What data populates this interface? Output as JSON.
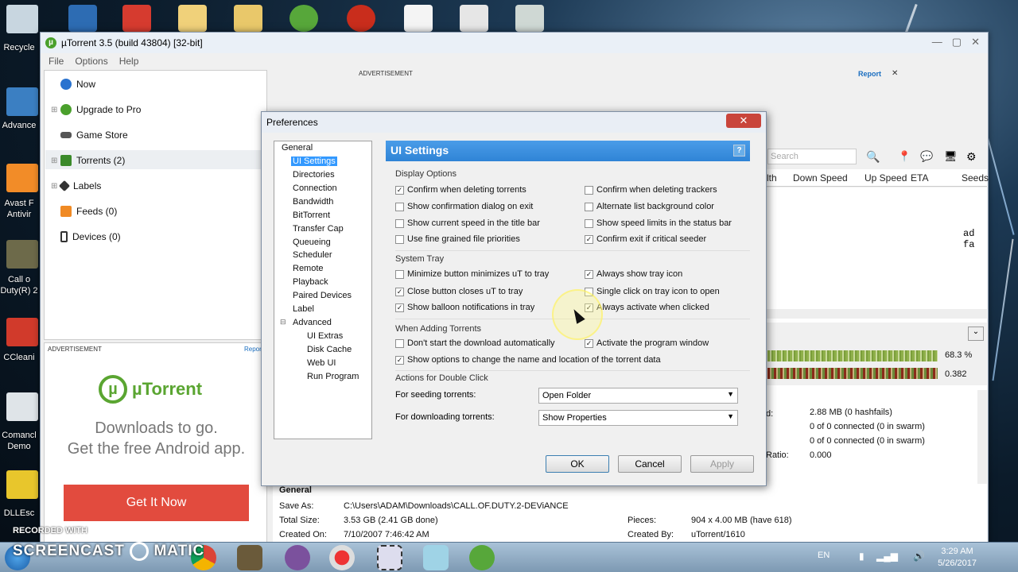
{
  "desktop": {
    "labels": [
      "Recycle",
      "Advance",
      "Avast F",
      "Antivir",
      "Call o",
      "Duty(R) 2",
      "CCleani",
      "Comancl",
      "Demo",
      "DLLEsc"
    ]
  },
  "window": {
    "title": "µTorrent 3.5  (build 43804) [32-bit]",
    "menu": [
      "File",
      "Options",
      "Help"
    ]
  },
  "sidebar": {
    "items": [
      "Now",
      "Upgrade to Pro",
      "Game Store",
      "Torrents (2)",
      "Labels",
      "Feeds (0)",
      "Devices (0)"
    ]
  },
  "ad_left": {
    "label": "ADVERTISEMENT",
    "report": "Report",
    "brand": "µTorrent",
    "line1": "Downloads to go.",
    "line2": "Get the free Android app.",
    "button": "Get It Now"
  },
  "ad_top": {
    "label": "ADVERTISEMENT",
    "report": "Report",
    "close": "✕"
  },
  "toolbar": {
    "search_placeholder": "Search"
  },
  "columns": [
    "lth",
    "Down Speed",
    "Up Speed",
    "ETA",
    "Seeds"
  ],
  "right_text": "ad fa",
  "progress": {
    "pct1": "68.3 %",
    "pct2": "0.382",
    "fill1": 0.683
  },
  "details_right": [
    "2.88 MB (0 hashfails)",
    "0 of 0 connected (0 in swarm)",
    "0 of 0 connected (0 in swarm)",
    "0.000"
  ],
  "details_labels": {
    "d": "d:",
    "ratio": "Ratio:"
  },
  "general": {
    "header": "General",
    "save_as_label": "Save As:",
    "save_as": "C:\\Users\\ADAM\\Downloads\\CALL.OF.DUTY.2-DEViANCE",
    "total_size_label": "Total Size:",
    "total_size": "3.53 GB (2.41 GB done)",
    "created_on_label": "Created On:",
    "created_on": "7/10/2007 7:46:42 AM",
    "pieces_label": "Pieces:",
    "pieces": "904 x 4.00 MB (have 618)",
    "created_by_label": "Created By:",
    "created_by": "uTorrent/1610"
  },
  "dialog": {
    "title": "Preferences",
    "tree": [
      "General",
      "UI Settings",
      "Directories",
      "Connection",
      "Bandwidth",
      "BitTorrent",
      "Transfer Cap",
      "Queueing",
      "Scheduler",
      "Remote",
      "Playback",
      "Paired Devices",
      "Label",
      "Advanced",
      "UI Extras",
      "Disk Cache",
      "Web UI",
      "Run Program"
    ],
    "panel_title": "UI Settings",
    "help": "?",
    "sections": {
      "display": "Display Options",
      "tray": "System Tray",
      "adding": "When Adding Torrents",
      "double": "Actions for Double Click"
    },
    "checks": {
      "c1": "Confirm when deleting torrents",
      "c2": "Confirm when deleting trackers",
      "c3": "Show confirmation dialog on exit",
      "c4": "Alternate list background color",
      "c5": "Show current speed in the title bar",
      "c6": "Show speed limits in the status bar",
      "c7": "Use fine grained file priorities",
      "c8": "Confirm exit if critical seeder",
      "t1": "Minimize button minimizes uT to tray",
      "t2": "Always show tray icon",
      "t3": "Close button closes uT to tray",
      "t4": "Single click on tray icon to open",
      "t5": "Show balloon notifications in tray",
      "t6": "Always activate when clicked",
      "a1": "Don't start the download automatically",
      "a2": "Activate the program window",
      "a3": "Show options to change the name and location of the torrent data"
    },
    "seeding_label": "For seeding torrents:",
    "seeding_value": "Open Folder",
    "downloading_label": "For downloading torrents:",
    "downloading_value": "Show Properties",
    "ok": "OK",
    "cancel": "Cancel",
    "apply": "Apply"
  },
  "watermark": {
    "line1": "RECORDED WITH",
    "line2": "SCREENCAST",
    "line3": "MATIC"
  },
  "taskbar": {
    "lang": "EN",
    "time": "3:29 AM",
    "date": "5/26/2017"
  }
}
